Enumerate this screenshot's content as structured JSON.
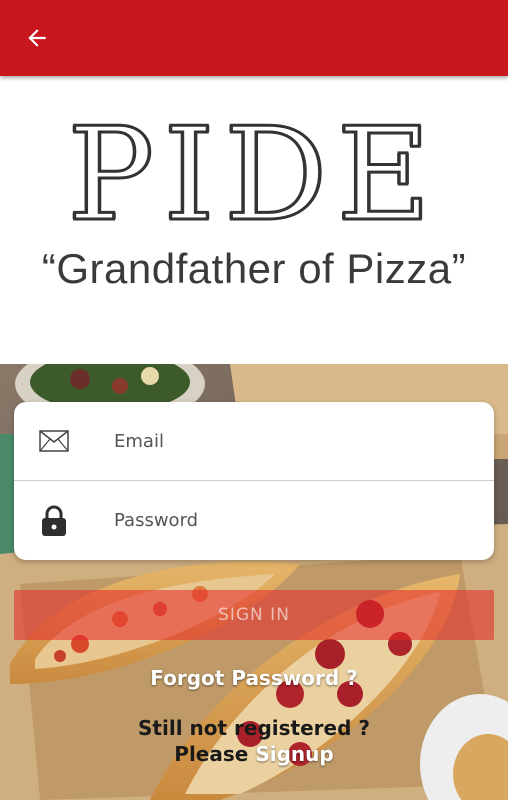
{
  "appbar": {
    "color": "#c8161d",
    "back_icon": "arrow-left-icon"
  },
  "logo": {
    "wordmark": "PIDE",
    "tagline": "“Grandfather of Pizza”"
  },
  "form": {
    "email": {
      "icon": "envelope-icon",
      "placeholder": "Email",
      "value": ""
    },
    "password": {
      "icon": "lock-icon",
      "placeholder": "Password",
      "value": ""
    },
    "signin_label": "SIGN IN"
  },
  "links": {
    "forgot": "Forgot Password ?",
    "register_prompt": "Still not registered ?",
    "signup_prefix": "Please",
    "signup_link": "Signup"
  },
  "background": {
    "description_icon": "pizza-photo-background"
  }
}
